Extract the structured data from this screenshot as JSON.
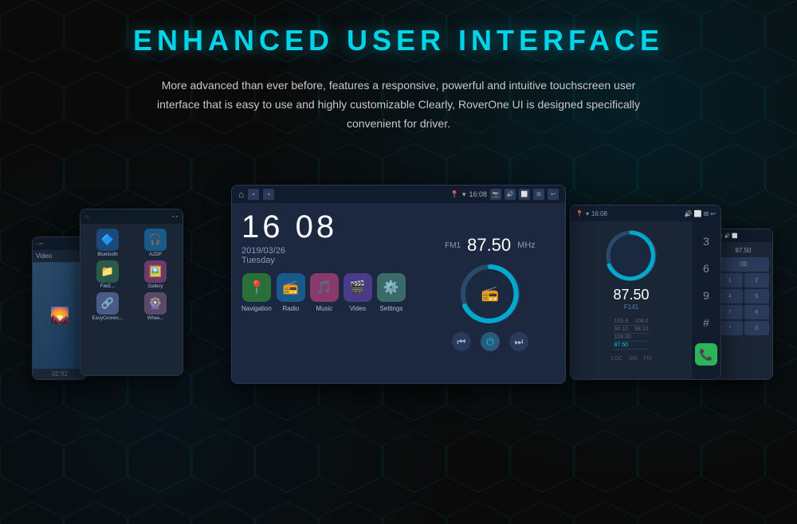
{
  "page": {
    "title": "ENHANCED USER INTERFACE",
    "subtitle": "More advanced than ever before, features a responsive, powerful and intuitive touchscreen user interface that is easy to use and highly customizable Clearly, RoverOne UI is designed specifically convenient for driver."
  },
  "center_screen": {
    "time": "16 08",
    "date": "2019/03/26",
    "day": "Tuesday",
    "fm_label": "FM1",
    "fm_freq": "87.50",
    "fm_unit": "MHz",
    "status_time": "16:08",
    "apps": [
      {
        "label": "Navigation",
        "color": "#2a6e3a",
        "icon": "📍"
      },
      {
        "label": "Radio",
        "color": "#1a5a8a",
        "icon": "📻"
      },
      {
        "label": "Music",
        "color": "#8a3a6a",
        "icon": "🎵"
      },
      {
        "label": "Video",
        "color": "#4a3a8a",
        "icon": "🎬"
      },
      {
        "label": "Settings",
        "color": "#3a6a6a",
        "icon": "⚙️"
      }
    ]
  },
  "left_screen": {
    "header": "Video",
    "time": "02:92"
  },
  "left_small_screen": {
    "apps": [
      {
        "label": "Bluetooth",
        "color": "#1a4a7a",
        "icon": "🔷"
      },
      {
        "label": "A2DP",
        "color": "#1a5a8a",
        "icon": "🎧"
      },
      {
        "label": "FileEx...",
        "color": "#2a5a4a",
        "icon": "📁"
      },
      {
        "label": "Gallery",
        "color": "#6a3a6a",
        "icon": "🖼️"
      },
      {
        "label": "EasyConnec...",
        "color": "#4a5a8a",
        "icon": "🔗"
      },
      {
        "label": "Whee...",
        "color": "#5a4a6a",
        "icon": "🎡"
      }
    ]
  },
  "right_screen": {
    "freq": "87.50",
    "sub": "F141",
    "scale": [
      {
        "val": "103.9",
        "right": "108.0",
        "highlight": false
      },
      {
        "val": "90.10",
        "right": "98.10",
        "highlight": false
      },
      {
        "val": "108.00",
        "right": "",
        "highlight": false
      },
      {
        "val": "87.50",
        "right": "",
        "highlight": true
      }
    ],
    "labels": [
      "LOC",
      "AM",
      "FM"
    ],
    "nums": [
      "3",
      "6",
      "9",
      "#"
    ],
    "status_time": "16:08"
  },
  "colors": {
    "accent": "#00d4e8",
    "bg": "#0a0a0a",
    "screen_bg": "#1c2840",
    "text_primary": "#ffffff",
    "text_secondary": "#8899bb",
    "green": "#2ab55a"
  }
}
